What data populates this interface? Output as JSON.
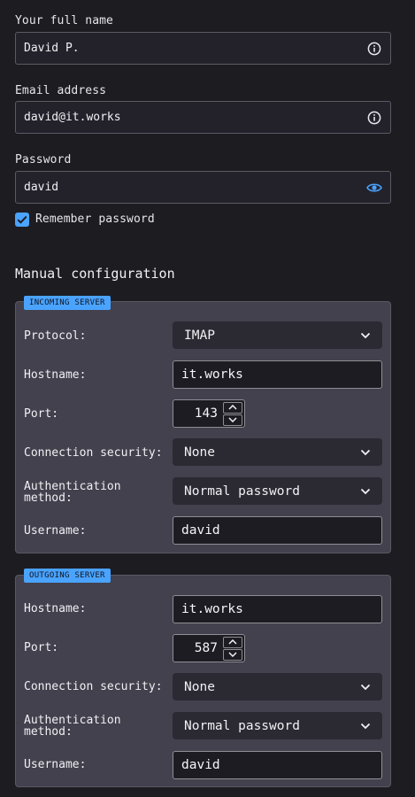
{
  "account": {
    "full_name_label": "Your full name",
    "full_name_value": "David P.",
    "email_label": "Email address",
    "email_value": "david@it.works",
    "password_label": "Password",
    "password_value": "david",
    "remember_label": "Remember password",
    "remember_checked": true
  },
  "manual": {
    "title": "Manual configuration",
    "incoming": {
      "badge": "INCOMING SERVER",
      "protocol_label": "Protocol:",
      "protocol_value": "IMAP",
      "hostname_label": "Hostname:",
      "hostname_value": "it.works",
      "port_label": "Port:",
      "port_value": "143",
      "security_label": "Connection security:",
      "security_value": "None",
      "auth_label_line1": "Authentication",
      "auth_label_line2": "method:",
      "auth_value": "Normal password",
      "username_label": "Username:",
      "username_value": "david"
    },
    "outgoing": {
      "badge": "OUTGOING SERVER",
      "hostname_label": "Hostname:",
      "hostname_value": "it.works",
      "port_label": "Port:",
      "port_value": "587",
      "security_label": "Connection security:",
      "security_value": "None",
      "auth_label_line1": "Authentication",
      "auth_label_line2": "method:",
      "auth_value": "Normal password",
      "username_label": "Username:",
      "username_value": "david"
    }
  },
  "colors": {
    "accent": "#4aa3ff",
    "background": "#1d1c21",
    "panel": "#42414d"
  },
  "icons": {
    "info": "info-icon",
    "eye": "eye-icon",
    "check": "check-icon",
    "chevron": "chevron-down-icon",
    "spin_up": "chevron-up-icon",
    "spin_down": "chevron-down-icon"
  }
}
